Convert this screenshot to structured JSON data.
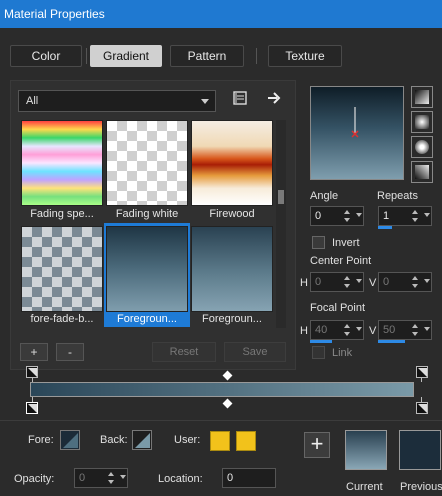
{
  "window": {
    "title": "Material Properties"
  },
  "tabs": [
    {
      "label": "Color",
      "active": false
    },
    {
      "label": "Gradient",
      "active": true
    },
    {
      "label": "Pattern",
      "active": false
    },
    {
      "label": "Texture",
      "active": false
    }
  ],
  "library": {
    "category": "All",
    "items": [
      {
        "label": "Fading spe...",
        "selected": false
      },
      {
        "label": "Fading white",
        "selected": false
      },
      {
        "label": "Firewood",
        "selected": false
      },
      {
        "label": "fore-fade-b...",
        "selected": false
      },
      {
        "label": "Foregroun...",
        "selected": true
      },
      {
        "label": "Foregroun...",
        "selected": false
      }
    ],
    "add_label": "+",
    "remove_label": "-",
    "reset_label": "Reset",
    "save_label": "Save"
  },
  "settings": {
    "angle_label": "Angle",
    "angle_value": "0",
    "repeats_label": "Repeats",
    "repeats_value": "1",
    "invert_label": "Invert",
    "center_point_label": "Center Point",
    "center_h_label": "H",
    "center_h_value": "0",
    "center_v_label": "V",
    "center_v_value": "0",
    "focal_point_label": "Focal Point",
    "focal_h_label": "H",
    "focal_h_value": "40",
    "focal_v_label": "V",
    "focal_v_value": "50",
    "link_label": "Link"
  },
  "editor": {
    "fore_label": "Fore:",
    "back_label": "Back:",
    "user_label": "User:",
    "user_color": "#f2c21b",
    "opacity_label": "Opacity:",
    "opacity_value": "0",
    "location_label": "Location:",
    "location_value": "0"
  },
  "swatches": {
    "add_label": "+",
    "current_label": "Current",
    "previous_label": "Previous"
  },
  "colors": {
    "accent": "#1f79d1",
    "gradient_start": "#2a4658",
    "gradient_end": "#7a9aa8"
  }
}
